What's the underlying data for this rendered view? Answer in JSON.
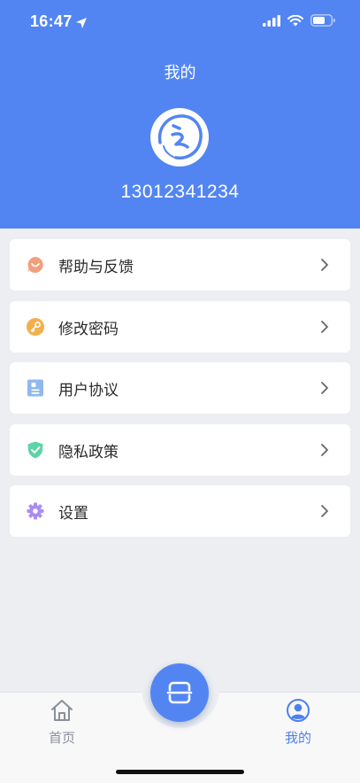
{
  "status_bar": {
    "time": "16:47"
  },
  "header": {
    "title": "我的",
    "phone": "13012341234"
  },
  "menu": [
    {
      "label": "帮助与反馈",
      "icon": "smile-bubble-icon",
      "color": "#f0a07e"
    },
    {
      "label": "修改密码",
      "icon": "key-icon",
      "color": "#f2b04c"
    },
    {
      "label": "用户协议",
      "icon": "document-icon",
      "color": "#8fb8ef"
    },
    {
      "label": "隐私政策",
      "icon": "shield-check-icon",
      "color": "#5fd3a6"
    },
    {
      "label": "设置",
      "icon": "gear-icon",
      "color": "#a98df0"
    }
  ],
  "tabbar": {
    "home_label": "首页",
    "mine_label": "我的",
    "active_tab": "我的"
  },
  "colors": {
    "primary": "#5385f2",
    "background": "#eceef1",
    "active_tab": "#4d80f0",
    "inactive_tab": "#8a8f99"
  }
}
